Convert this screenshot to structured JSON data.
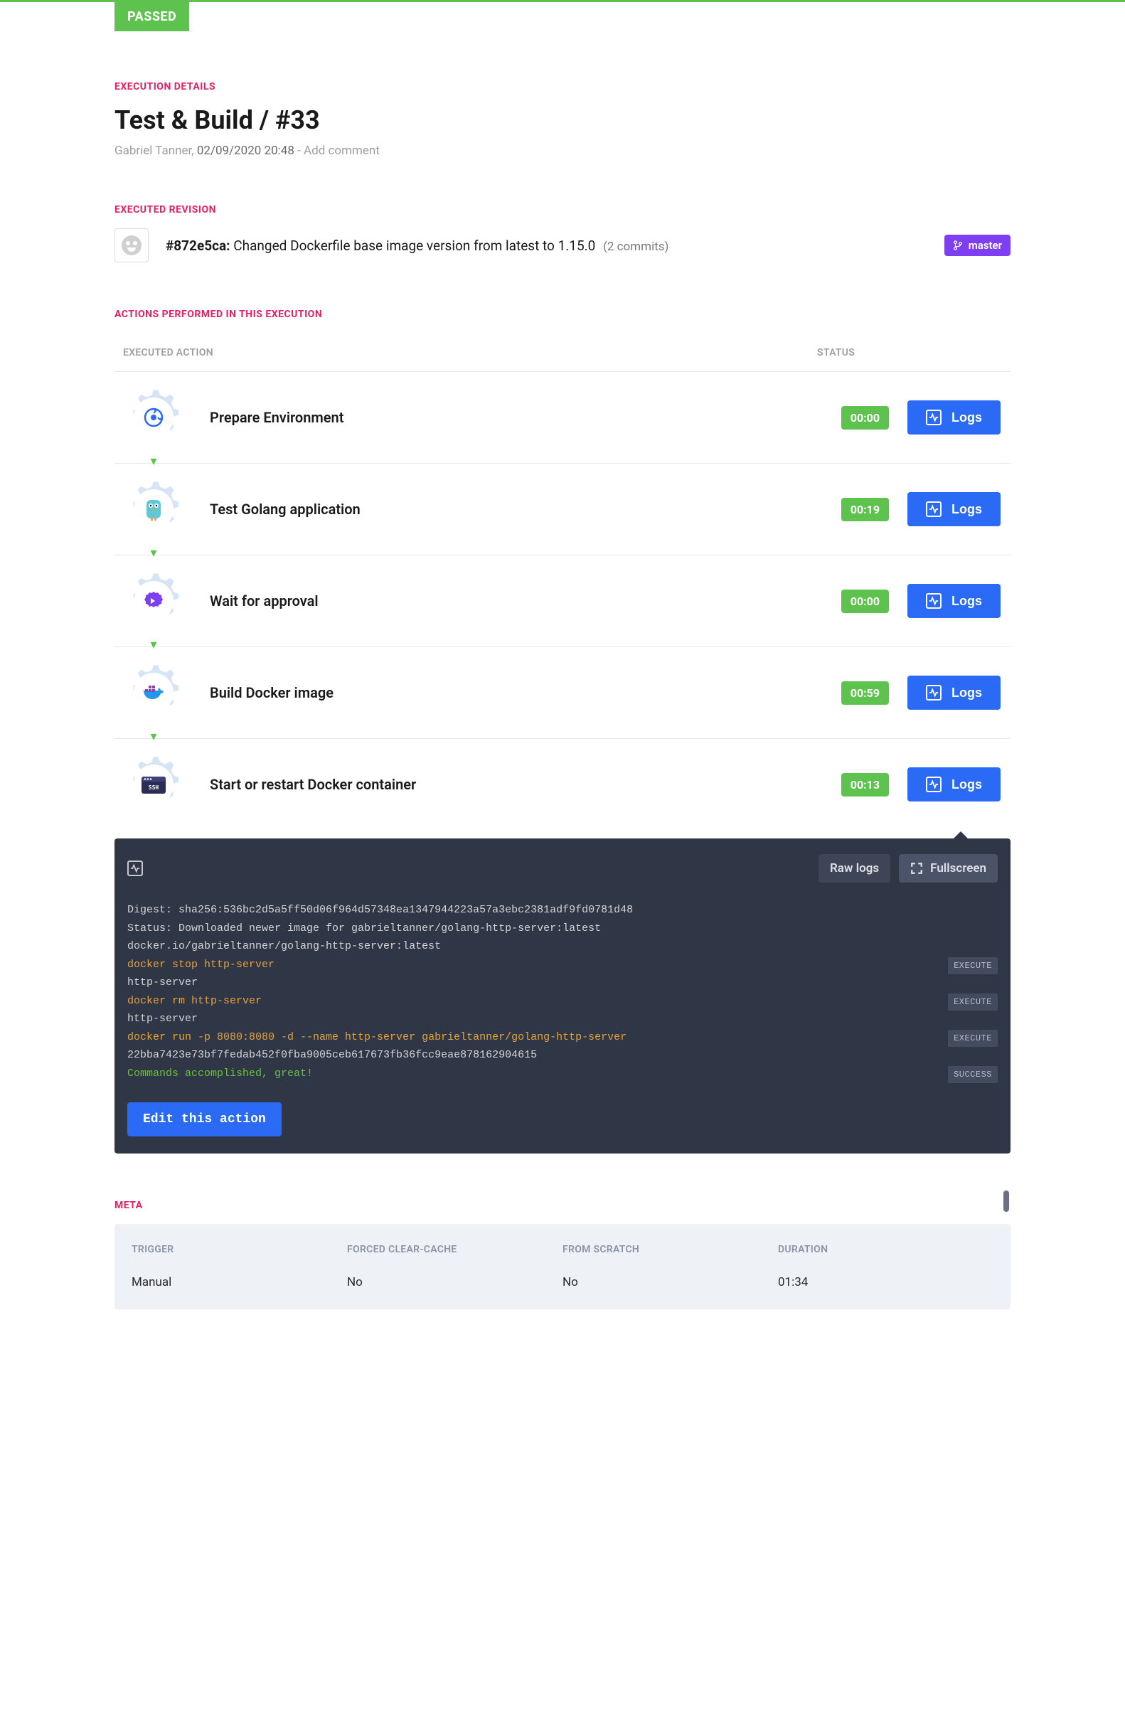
{
  "status_badge": "PASSED",
  "section_exec_details": "EXECUTION DETAILS",
  "page_title": "Test & Build / #33",
  "author": "Gabriel Tanner,",
  "timestamp": "02/09/2020 20:48",
  "add_comment": "Add comment",
  "section_revision": "EXECUTED REVISION",
  "revision": {
    "hash": "#872e5ca:",
    "message": "Changed Dockerfile base image version from latest to 1.15.0",
    "commits_link": "(2 commits)",
    "branch": "master"
  },
  "section_actions": "ACTIONS PERFORMED IN THIS EXECUTION",
  "col_action": "EXECUTED ACTION",
  "col_status": "STATUS",
  "logs_btn": "Logs",
  "actions": [
    {
      "name": "Prepare Environment",
      "duration": "00:00",
      "icon": "prepare"
    },
    {
      "name": "Test Golang application",
      "duration": "00:19",
      "icon": "gopher"
    },
    {
      "name": "Wait for approval",
      "duration": "00:00",
      "icon": "approval"
    },
    {
      "name": "Build Docker image",
      "duration": "00:59",
      "icon": "docker"
    },
    {
      "name": "Start or restart Docker container",
      "duration": "00:13",
      "icon": "ssh"
    }
  ],
  "log_panel": {
    "raw_logs": "Raw logs",
    "fullscreen": "Fullscreen",
    "lines": [
      {
        "text": "Digest: sha256:536bc2d5a5ff50d06f964d57348ea1347944223a57a3ebc2381adf9fd0781d48",
        "cls": ""
      },
      {
        "text": "Status: Downloaded newer image for gabrieltanner/golang-http-server:latest",
        "cls": ""
      },
      {
        "text": "docker.io/gabrieltanner/golang-http-server:latest",
        "cls": ""
      },
      {
        "text": "docker stop http-server",
        "cls": "orange",
        "tag": "EXECUTE"
      },
      {
        "text": "http-server",
        "cls": ""
      },
      {
        "text": "docker rm http-server",
        "cls": "orange",
        "tag": "EXECUTE"
      },
      {
        "text": "http-server",
        "cls": ""
      },
      {
        "text": "docker run -p 8080:8080 -d --name http-server gabrieltanner/golang-http-server",
        "cls": "orange",
        "tag": "EXECUTE"
      },
      {
        "text": "22bba7423e73bf7fedab452f0fba9005ceb617673fb36fcc9eae878162904615",
        "cls": ""
      },
      {
        "text": "Commands accomplished, great!",
        "cls": "green",
        "tag": "SUCCESS"
      }
    ],
    "edit_action": "Edit this action"
  },
  "section_meta": "META",
  "meta": {
    "headers": {
      "trigger": "TRIGGER",
      "cache": "FORCED CLEAR-CACHE",
      "scratch": "FROM SCRATCH",
      "duration": "DURATION"
    },
    "values": {
      "trigger": "Manual",
      "cache": "No",
      "scratch": "No",
      "duration": "01:34"
    }
  }
}
